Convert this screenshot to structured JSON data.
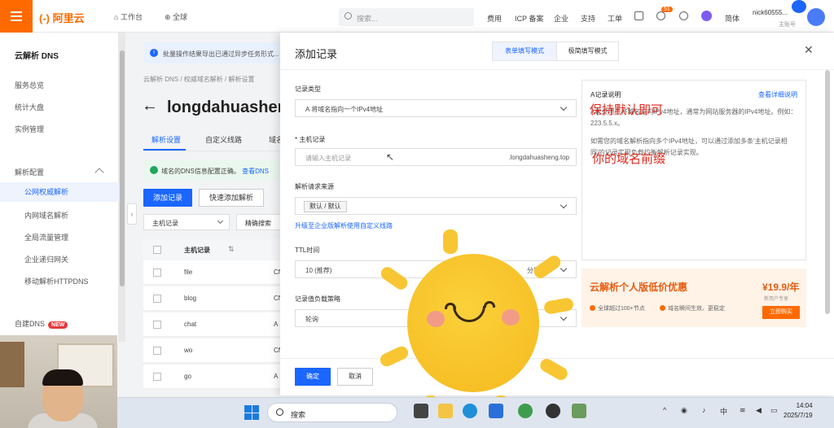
{
  "topbar": {
    "logo": "阿里云",
    "workbench": "工作台",
    "region": "全球",
    "search_placeholder": "搜索...",
    "nav": [
      "费用",
      "ICP 备案",
      "企业",
      "支持",
      "工单"
    ],
    "notif_count": "51",
    "lang": "简体",
    "username": "nick60555...",
    "user_sub": "主账号"
  },
  "sidebar": {
    "title": "云解析 DNS",
    "items": [
      "服务总览",
      "统计大盘",
      "实例管理"
    ],
    "section": "解析配置",
    "subitems": [
      "公网权威解析",
      "内网域名解析",
      "全局流量管理",
      "企业递归网关",
      "移动解析HTTPDNS"
    ],
    "bottom": "自建DNS",
    "new_badge": "NEW"
  },
  "main": {
    "info": "批量操作结果导出已通过异步任务形式...",
    "breadcrumb": "云解析 DNS  /  权威域名解析  /  解析设置",
    "domain": "longdahuasheng.top",
    "tabs": [
      "解析设置",
      "自定义线路",
      "域名设置"
    ],
    "success_text": "域名的DNS信息配置正确。",
    "success_link": "查看DNS",
    "add_btn": "添加记录",
    "quick_btn": "快速添加解析",
    "filter": "主机记录",
    "filter2": "精确搜索",
    "col_host": "主机记录",
    "rows": [
      {
        "name": "file",
        "type": "CN"
      },
      {
        "name": "blog",
        "type": "CN"
      },
      {
        "name": "chat",
        "type": "A"
      },
      {
        "name": "wo",
        "type": "CN"
      },
      {
        "name": "go",
        "type": "A"
      }
    ]
  },
  "drawer": {
    "title": "添加记录",
    "mode_form": "表单填写模式",
    "mode_quick": "极简填写模式",
    "record_type_label": "记录类型",
    "record_type_value": "A 将域名指向一个IPv4地址",
    "host_label": "* 主机记录",
    "host_placeholder": "请输入主机记录",
    "host_suffix": ".longdahuasheng.top",
    "line_label": "解析请求来源",
    "line_value": "默认 / 默认",
    "line_link": "升级至企业版解析使用自定义线路",
    "ttl_label": "TTL时间",
    "ttl_value": "10 (推荐)",
    "ttl_unit": "分钟",
    "lb_label": "记录值负载策略",
    "lb_value": "轮询",
    "confirm": "确定",
    "cancel": "取消"
  },
  "help": {
    "title": "A记录说明",
    "link": "查看详细说明",
    "p1": "A记录用于将域名指向IPv4地址，通常为网站服务器的IPv4地址。例如：223.5.5.x。",
    "p2": "如需您的域名解析指向多个IPv4地址，可以通过添加多条‘主机记录相同’的记录实现负载均衡解析记录实现。"
  },
  "annotations": {
    "keep_default": "保持默认即可",
    "your_prefix": "你的域名前缀"
  },
  "promo": {
    "title": "云解析个人版低价优惠",
    "price": "¥19.9/年",
    "price_note": "新用户专享",
    "f1": "全球超过100+节点",
    "f2": "域名瞬间生效、更稳定",
    "buy": "立即购买"
  },
  "taskbar": {
    "search": "搜索",
    "ime": "中",
    "time": "14:04",
    "date": "2025/7/19"
  },
  "colors": {
    "brand": "#ff6a00",
    "primary": "#1a66ff",
    "annotation": "#e0261b"
  }
}
